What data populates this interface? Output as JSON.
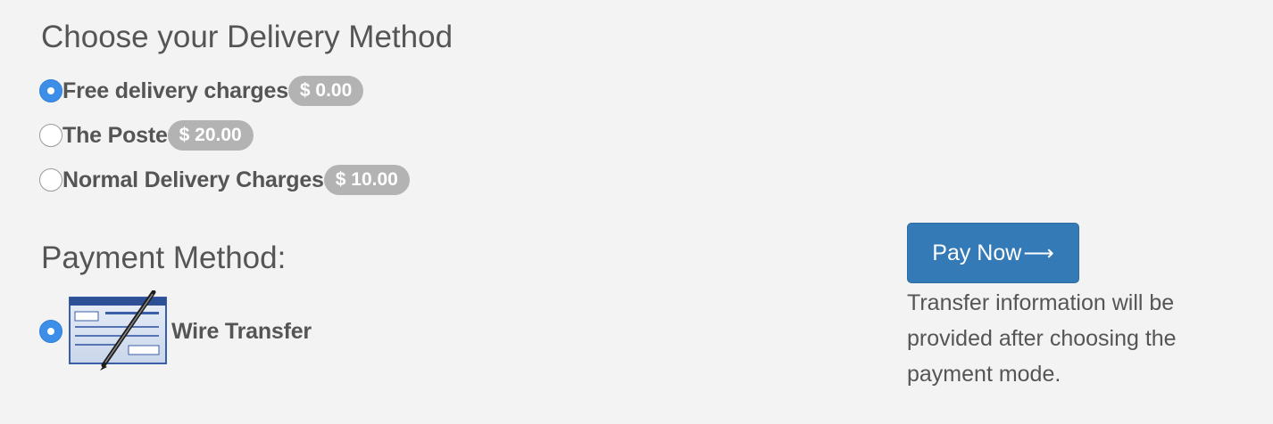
{
  "delivery": {
    "heading": "Choose your Delivery Method",
    "options": [
      {
        "label": "Free delivery charges",
        "price": "$ 0.00",
        "selected": true
      },
      {
        "label": "The Poste",
        "price": "$ 20.00",
        "selected": false
      },
      {
        "label": "Normal Delivery Charges",
        "price": "$ 10.00",
        "selected": false
      }
    ]
  },
  "payment": {
    "heading": "Payment Method:",
    "options": [
      {
        "label": "Wire Transfer",
        "icon": "cheque-pen-icon",
        "selected": true
      }
    ]
  },
  "actions": {
    "pay_now_label": "Pay Now",
    "pay_now_arrow": "⟶",
    "info_text": "Transfer information will be provided after choosing the payment mode."
  },
  "colors": {
    "page_background": "#f3f3f3",
    "text": "#555555",
    "radio_selected": "#3d8ee8",
    "price_badge": "#b3b3b3",
    "primary_button": "#337ab7"
  }
}
